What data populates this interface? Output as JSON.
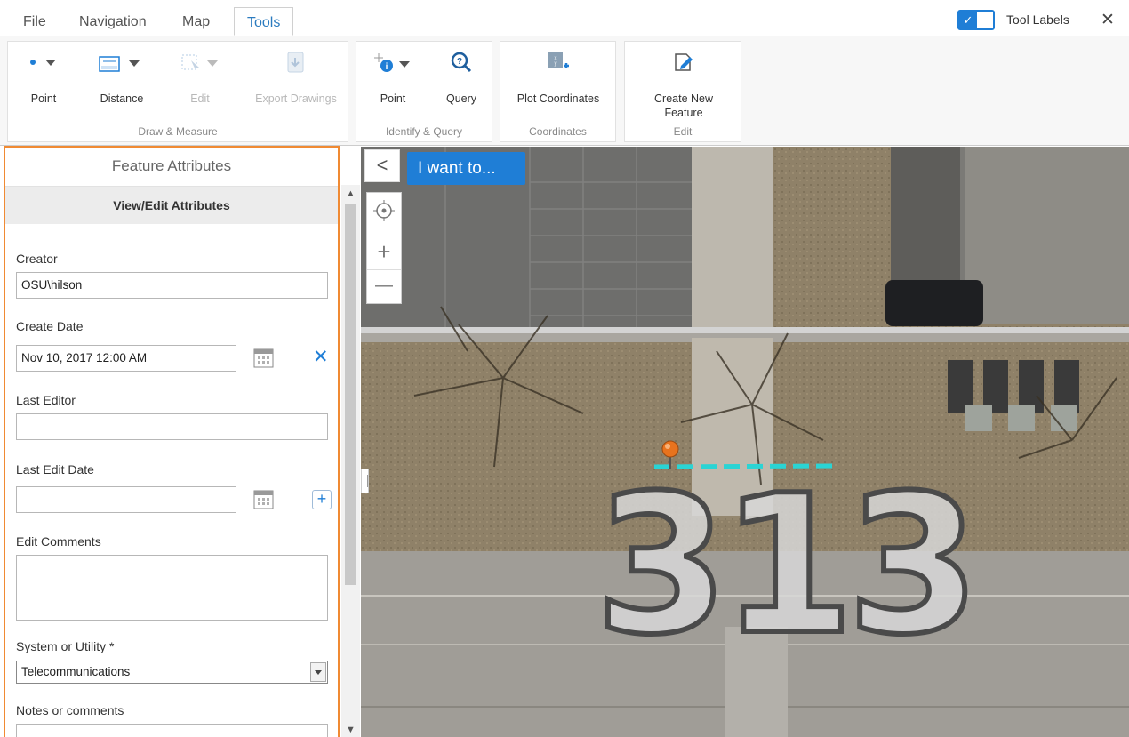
{
  "tabs": [
    {
      "label": "File",
      "active": false
    },
    {
      "label": "Navigation",
      "active": false
    },
    {
      "label": "Map",
      "active": false
    },
    {
      "label": "Tools",
      "active": true
    }
  ],
  "tool_labels": {
    "label": "Tool Labels",
    "checked": true
  },
  "close_glyph": "✕",
  "ribbon": {
    "draw_measure": {
      "group_label": "Draw & Measure",
      "point": "Point",
      "distance": "Distance",
      "edit": "Edit",
      "export": "Export Drawings"
    },
    "identify_query": {
      "group_label": "Identify & Query",
      "point": "Point",
      "query": "Query"
    },
    "coordinates": {
      "group_label": "Coordinates",
      "plot": "Plot Coordinates"
    },
    "edit": {
      "group_label": "Edit",
      "create_line1": "Create New",
      "create_line2": "Feature"
    }
  },
  "panel": {
    "title": "Feature Attributes",
    "subtitle": "View/Edit Attributes",
    "fields": {
      "creator_label": "Creator",
      "creator_value": "OSU\\hilson",
      "create_date_label": "Create Date",
      "create_date_value": "Nov 10, 2017 12:00 AM",
      "last_editor_label": "Last Editor",
      "last_editor_value": "",
      "last_edit_date_label": "Last Edit Date",
      "last_edit_date_value": "",
      "edit_comments_label": "Edit Comments",
      "edit_comments_value": "",
      "system_label": "System or Utility *",
      "system_value": "Telecommunications",
      "notes_label": "Notes or comments",
      "notes_value": ""
    }
  },
  "map": {
    "i_want_to": "I want to...",
    "collapse_glyph": "<",
    "zoom_in": "+",
    "zoom_out": "—",
    "building_label": "313"
  },
  "colors": {
    "accent": "#1f7ed6",
    "panel_border": "#f08a33",
    "measure_line": "#2ad4d4",
    "marker": "#e8731e"
  }
}
